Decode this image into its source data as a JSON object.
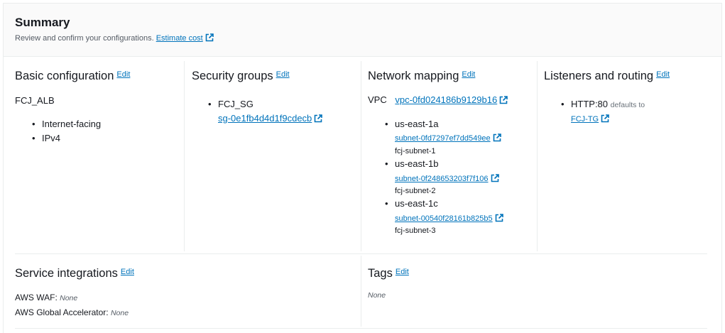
{
  "summary": {
    "title": "Summary",
    "description": "Review and confirm your configurations.",
    "estimate_cost": "Estimate cost"
  },
  "edit_label": "Edit",
  "basic": {
    "title": "Basic configuration",
    "name": "FCJ_ALB",
    "items": [
      "Internet-facing",
      "IPv4"
    ]
  },
  "security": {
    "title": "Security groups",
    "group_name": "FCJ_SG",
    "group_id": "sg-0e1fb4d4d1f9cdecb"
  },
  "network": {
    "title": "Network mapping",
    "vpc_label": "VPC",
    "vpc_id": "vpc-0fd024186b9129b16",
    "zones": [
      {
        "az": "us-east-1a",
        "subnet_id": "subnet-0fd7297ef7dd549ee",
        "subnet_name": "fcj-subnet-1"
      },
      {
        "az": "us-east-1b",
        "subnet_id": "subnet-0f248653203f7f106",
        "subnet_name": "fcj-subnet-2"
      },
      {
        "az": "us-east-1c",
        "subnet_id": "subnet-00540f28161b825b5",
        "subnet_name": "fcj-subnet-3"
      }
    ]
  },
  "listeners": {
    "title": "Listeners and routing",
    "listener": "HTTP:80",
    "defaults_to": "defaults to",
    "target_group": "FCJ-TG"
  },
  "service": {
    "title": "Service integrations",
    "waf_label": "AWS WAF:",
    "waf_value": "None",
    "ga_label": "AWS Global Accelerator:",
    "ga_value": "None"
  },
  "tags": {
    "title": "Tags",
    "value": "None"
  },
  "colors": {
    "link": "#0073bb",
    "text": "#16191f",
    "border": "#eaeded"
  }
}
